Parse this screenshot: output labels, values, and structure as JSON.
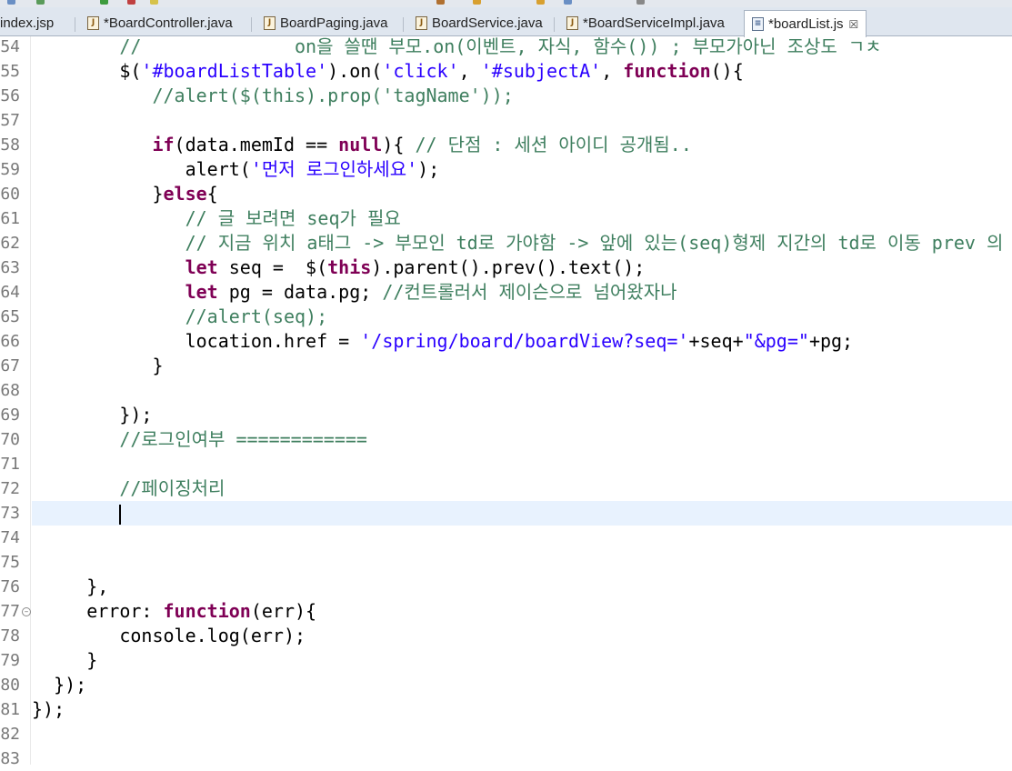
{
  "tabs": [
    {
      "label": "index.jsp",
      "dirty": false,
      "active": false,
      "icon": "jsp-file-icon"
    },
    {
      "label": "*BoardController.java",
      "dirty": true,
      "active": false,
      "icon": "java-file-icon"
    },
    {
      "label": "BoardPaging.java",
      "dirty": false,
      "active": false,
      "icon": "java-file-icon"
    },
    {
      "label": "BoardService.java",
      "dirty": false,
      "active": false,
      "icon": "java-file-icon"
    },
    {
      "label": "*BoardServiceImpl.java",
      "dirty": true,
      "active": false,
      "icon": "java-file-icon"
    },
    {
      "label": "*boardList.js",
      "dirty": true,
      "active": true,
      "icon": "js-file-icon",
      "close": "☒"
    }
  ],
  "editor": {
    "current_line": 73,
    "lines": [
      {
        "n": "54",
        "text": "        //              on을 쓸땐 부모.on(이벤트, 자식, 함수()) ; 부모가아닌 조상도 ㄱㅊ"
      },
      {
        "n": "55",
        "text": "        $('#boardListTable').on('click', '#subjectA', function(){"
      },
      {
        "n": "56",
        "text": "           //alert($(this).prop('tagName'));"
      },
      {
        "n": "57",
        "text": ""
      },
      {
        "n": "58",
        "text": "           if(data.memId == null){ // 단점 : 세션 아이디 공개됨.."
      },
      {
        "n": "59",
        "text": "              alert('먼저 로그인하세요');"
      },
      {
        "n": "60",
        "text": "           }else{"
      },
      {
        "n": "61",
        "text": "              // 글 보려면 seq가 필요"
      },
      {
        "n": "62",
        "text": "              // 지금 위치 a태그 -> 부모인 td로 가야함 -> 앞에 있는(seq)형제 지간의 td로 이동 prev 의"
      },
      {
        "n": "63",
        "text": "              let seq =  $(this).parent().prev().text();"
      },
      {
        "n": "64",
        "text": "              let pg = data.pg; //컨트롤러서 제이슨으로 넘어왔자나"
      },
      {
        "n": "65",
        "text": "              //alert(seq);"
      },
      {
        "n": "66",
        "text": "              location.href = '/spring/board/boardView?seq='+seq+\"&pg=\"+pg;"
      },
      {
        "n": "67",
        "text": "           }"
      },
      {
        "n": "68",
        "text": ""
      },
      {
        "n": "69",
        "text": "        });"
      },
      {
        "n": "70",
        "text": "        //로그인여부 ============"
      },
      {
        "n": "71",
        "text": ""
      },
      {
        "n": "72",
        "text": "        //페이징처리"
      },
      {
        "n": "73",
        "text": "        "
      },
      {
        "n": "74",
        "text": ""
      },
      {
        "n": "75",
        "text": ""
      },
      {
        "n": "76",
        "text": "     },"
      },
      {
        "n": "77",
        "text": "     error: function(err){"
      },
      {
        "n": "78",
        "text": "        console.log(err);"
      },
      {
        "n": "79",
        "text": "     }"
      },
      {
        "n": "80",
        "text": "  });"
      },
      {
        "n": "81",
        "text": "});"
      },
      {
        "n": "82",
        "text": ""
      },
      {
        "n": "83",
        "text": ""
      }
    ]
  }
}
